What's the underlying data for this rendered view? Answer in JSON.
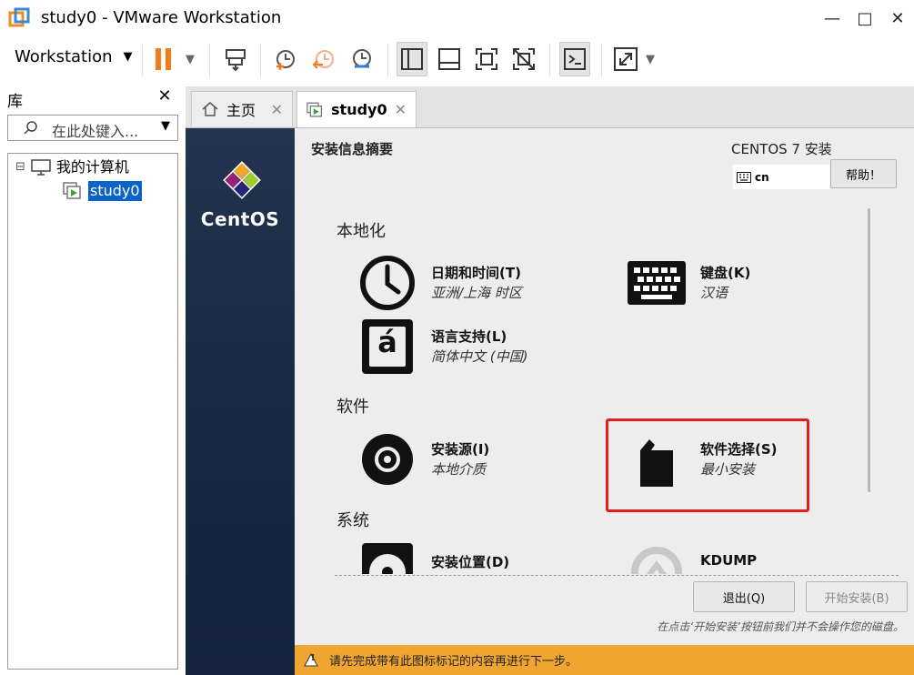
{
  "window": {
    "title": "study0 - VMware Workstation",
    "controls": {
      "minimize": "—",
      "maximize": "□",
      "close": "✕"
    }
  },
  "toolbar": {
    "menu_label": "Workstation",
    "menu_caret": "▼",
    "pause_caret": "▼",
    "fullscreen_caret": "▼"
  },
  "library": {
    "title": "库",
    "close": "✕",
    "search_placeholder": "在此处键入...",
    "search_caret": "▼",
    "tree": {
      "root_toggle": "⊟",
      "root_label": "我的计算机",
      "child_label": "study0"
    }
  },
  "tabs": [
    {
      "label": "主页",
      "close": "✕"
    },
    {
      "label": "study0",
      "close": "✕"
    }
  ],
  "vm": {
    "brand": "CentOS",
    "summary_title": "安装信息摘要",
    "install_title": "CENTOS 7 安装",
    "keyboard_layout": "cn",
    "help_label": "帮助！",
    "sections": {
      "localization": "本地化",
      "software": "软件",
      "system": "系统"
    },
    "spokes": {
      "datetime": {
        "name": "日期和时间(T)",
        "status": "亚洲/上海 时区"
      },
      "keyboard": {
        "name": "键盘(K)",
        "status": "汉语"
      },
      "language": {
        "name": "语言支持(L)",
        "status": "简体中文 (中国)",
        "glyph": "á"
      },
      "source": {
        "name": "安装源(I)",
        "status": "本地介质"
      },
      "software_selection": {
        "name": "软件选择(S)",
        "status": "最小安装"
      },
      "destination": {
        "name": "安装位置(D)"
      },
      "kdump": {
        "name": "KDUMP"
      }
    },
    "quit_label": "退出(Q)",
    "begin_label": "开始安装(B)",
    "note": "在点击‘开始安装’按钮前我们并不会操作您的磁盘。",
    "warning": "请先完成带有此图标标记的内容再进行下一步。",
    "warning_icon": "!"
  },
  "colors": {
    "highlight": "#e0201c",
    "warning_bar": "#f0a530",
    "sidebar": "#1a2a45",
    "pause": "#f07c1b"
  }
}
